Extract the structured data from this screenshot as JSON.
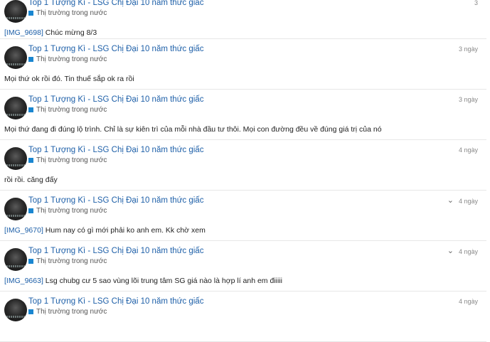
{
  "posts": [
    {
      "author": "Top 1 Tượng Kì - LSG Chị Đại 10 năm thức giấc",
      "category": "Thị trường trong nước",
      "time": "3",
      "chevron": false,
      "link": "[IMG_9698]",
      "text": " Chúc mừng 8/3"
    },
    {
      "author": "Top 1 Tượng Kì - LSG Chị Đại 10 năm thức giấc",
      "category": "Thị trường trong nước",
      "time": "3 ngày",
      "chevron": false,
      "link": "",
      "text": "Mọi thứ ok rồi đó. Tin thuế sắp ok ra rồi"
    },
    {
      "author": "Top 1 Tượng Kì - LSG Chị Đại 10 năm thức giấc",
      "category": "Thị trường trong nước",
      "time": "3 ngày",
      "chevron": false,
      "link": "",
      "text": "Mọi thứ đang đi đúng lộ trình. Chỉ là sự kiên trì của mỗi nhà đầu tư thôi. Mọi con đường đều về đúng giá trị của nó"
    },
    {
      "author": "Top 1 Tượng Kì - LSG Chị Đại 10 năm thức giấc",
      "category": "Thị trường trong nước",
      "time": "4 ngày",
      "chevron": false,
      "link": "",
      "text": "rồi rồi. căng đấy"
    },
    {
      "author": "Top 1 Tượng Kì - LSG Chị Đại 10 năm thức giấc",
      "category": "Thị trường trong nước",
      "time": "4 ngày",
      "chevron": true,
      "link": "[IMG_9670]",
      "text": " Hum nay có gì mới phải ko anh em. Kk chờ xem"
    },
    {
      "author": "Top 1 Tượng Kì - LSG Chị Đại 10 năm thức giấc",
      "category": "Thị trường trong nước",
      "time": "4 ngày",
      "chevron": true,
      "link": "[IMG_9663]",
      "text": " Lsg chubg cư 5 sao vùng lõi trung tâm SG giá nào là hợp lí anh em điiiii"
    },
    {
      "author": "Top 1 Tượng Kì - LSG Chị Đại 10 năm thức giấc",
      "category": "Thị trường trong nước",
      "time": "4 ngày",
      "chevron": false,
      "link": "",
      "text": ""
    }
  ]
}
